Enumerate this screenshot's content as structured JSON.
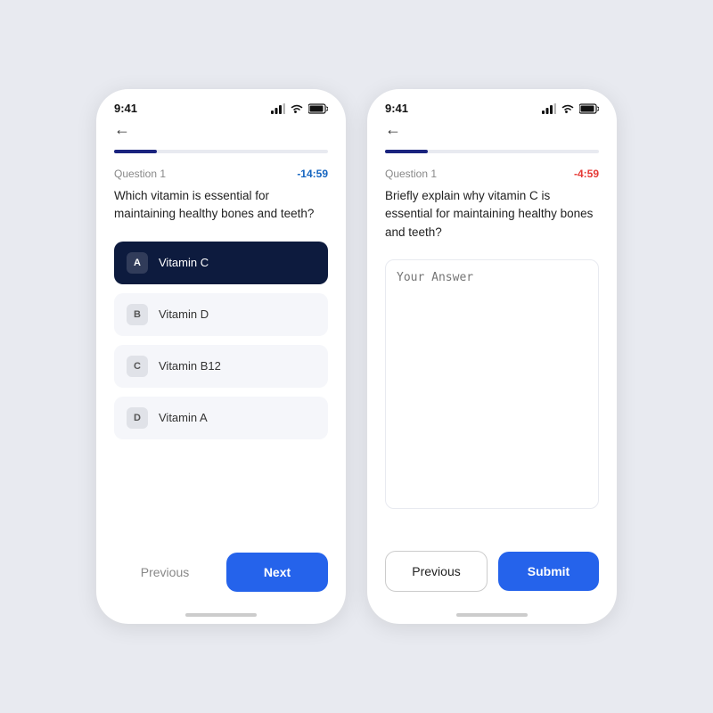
{
  "phone1": {
    "status_bar": {
      "time": "9:41"
    },
    "progress": 20,
    "question_label": "Question 1",
    "timer": "-14:59",
    "timer_class": "timer-blue",
    "question_text": "Which vitamin is essential for maintaining healthy bones and teeth?",
    "options": [
      {
        "letter": "A",
        "text": "Vitamin C",
        "selected": true
      },
      {
        "letter": "B",
        "text": "Vitamin D",
        "selected": false
      },
      {
        "letter": "C",
        "text": "Vitamin B12",
        "selected": false
      },
      {
        "letter": "D",
        "text": "Vitamin A",
        "selected": false
      }
    ],
    "footer": {
      "previous_label": "Previous",
      "next_label": "Next"
    }
  },
  "phone2": {
    "status_bar": {
      "time": "9:41"
    },
    "progress": 20,
    "question_label": "Question 1",
    "timer": "-4:59",
    "timer_class": "timer-red",
    "question_text": "Briefly explain why vitamin C is essential for maintaining healthy bones and teeth?",
    "answer_placeholder": "Your Answer",
    "footer": {
      "previous_label": "Previous",
      "submit_label": "Submit"
    }
  }
}
